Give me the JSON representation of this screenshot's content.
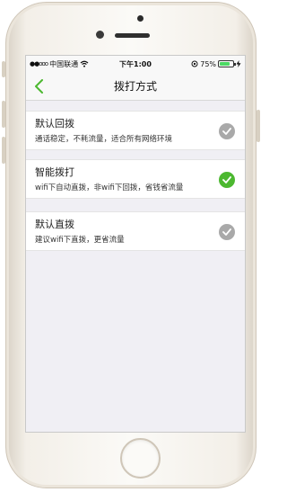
{
  "status_bar": {
    "signal": "●●ooo",
    "carrier": "中国联通",
    "wifi_icon": "wifi-icon",
    "time": "下午1:00",
    "battery_percent": "75%",
    "battery_level": 0.75
  },
  "nav": {
    "title": "拨打方式",
    "back_icon": "chevron-left-icon"
  },
  "colors": {
    "accent": "#4cb830",
    "check_inactive": "#a9a9a9",
    "background": "#f0eff4"
  },
  "options": [
    {
      "title": "默认回拨",
      "desc": "通话稳定，不耗流量，适合所有网络环境",
      "selected": false
    },
    {
      "title": "智能拨打",
      "desc": "wifi下自动直拨，非wifi下回拨，省钱省流量",
      "selected": true
    },
    {
      "title": "默认直拨",
      "desc": "建议wifi下直拨，更省流量",
      "selected": false
    }
  ]
}
